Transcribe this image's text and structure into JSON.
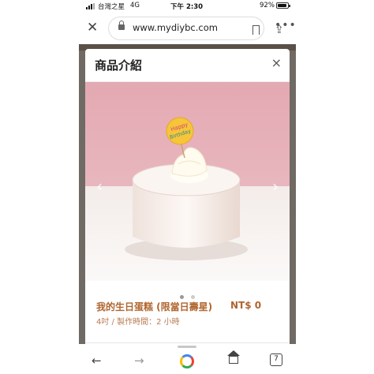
{
  "status_bar": {
    "carrier": "台灣之星",
    "network": "4G",
    "time": "下午 2:30",
    "battery_percent": "92%",
    "battery_level": 0.92
  },
  "browser": {
    "url": "www.mydiybc.com",
    "tab_count": "7",
    "icons": [
      "close-icon",
      "lock-icon",
      "bookmark-icon",
      "share-icon",
      "more-icon",
      "back-icon",
      "forward-icon",
      "google-icon",
      "home-icon",
      "tabs-icon"
    ]
  },
  "modal": {
    "title": "商品介紹",
    "close_label": "×",
    "carousel": {
      "prev_label": "‹",
      "next_label": "›",
      "dot_count": 2,
      "active_index": 0,
      "topper_text": "Happy Birthday"
    },
    "product": {
      "name": "我的生日蛋糕 (限當日壽星)",
      "price": "NT$ 0",
      "meta": "4吋 / 製作時間：2 小時"
    }
  },
  "colors": {
    "accent": "#b0652e",
    "photo_background": "#e6b7bf"
  }
}
